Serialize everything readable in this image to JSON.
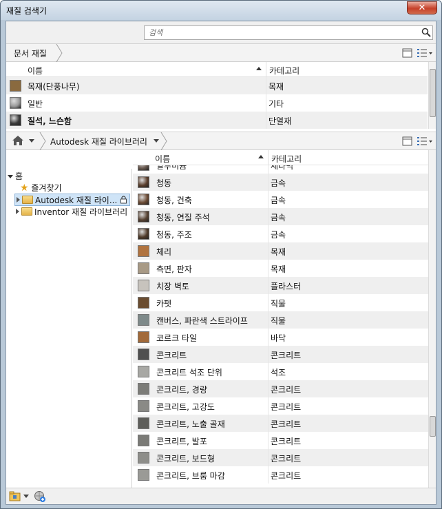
{
  "window": {
    "title": "재질 검색기",
    "close_label": "✕"
  },
  "search": {
    "placeholder": "검색"
  },
  "document": {
    "breadcrumb": "문서 재질",
    "columns": {
      "name": "이름",
      "category": "카테고리"
    },
    "rows": [
      {
        "name": "목재(단풍나무)",
        "category": "목재",
        "swatch": "#8a6a3f",
        "bold": false
      },
      {
        "name": "일반",
        "category": "기타",
        "swatch": "#9a9a9a",
        "bold": false
      },
      {
        "name": "질석, 느슨함",
        "category": "단열재",
        "swatch": "#3a3a3a",
        "bold": true
      }
    ]
  },
  "library": {
    "breadcrumb": "Autodesk 재질 라이브러리",
    "columns": {
      "name": "이름",
      "category": "카테고리"
    },
    "partial_top": {
      "name": "알루미늄",
      "category": "세라믹"
    },
    "rows": [
      {
        "name": "청동",
        "category": "금속",
        "swatch": "#5a3e2c"
      },
      {
        "name": "청동, 건축",
        "category": "금속",
        "swatch": "#6b4a33"
      },
      {
        "name": "청동, 연질 주석",
        "category": "금속",
        "swatch": "#574232"
      },
      {
        "name": "청동, 주조",
        "category": "금속",
        "swatch": "#4f3a2a"
      },
      {
        "name": "체리",
        "category": "목재",
        "swatch": "#b0733f"
      },
      {
        "name": "측면, 판자",
        "category": "목재",
        "swatch": "#a89a86"
      },
      {
        "name": "치장 벽토",
        "category": "플라스터",
        "swatch": "#c7c3bd"
      },
      {
        "name": "카펫",
        "category": "직물",
        "swatch": "#6a4c30"
      },
      {
        "name": "캔버스, 파란색 스트라이프",
        "category": "직물",
        "swatch": "#7f8a8a"
      },
      {
        "name": "코르크 타일",
        "category": "바닥",
        "swatch": "#a26a3a"
      },
      {
        "name": "콘크리트",
        "category": "콘크리트",
        "swatch": "#4f4f4f"
      },
      {
        "name": "콘크리트 석조 단위",
        "category": "석조",
        "swatch": "#a8a8a4"
      },
      {
        "name": "콘크리트, 경량",
        "category": "콘크리트",
        "swatch": "#7c7c78"
      },
      {
        "name": "콘크리트, 고강도",
        "category": "콘크리트",
        "swatch": "#8a8a86"
      },
      {
        "name": "콘크리트, 노출 골재",
        "category": "콘크리트",
        "swatch": "#5e5e5a"
      },
      {
        "name": "콘크리트, 발포",
        "category": "콘크리트",
        "swatch": "#7a7a76"
      },
      {
        "name": "콘크리트, 보드형",
        "category": "콘크리트",
        "swatch": "#8e8e8a"
      },
      {
        "name": "콘크리트, 브룸 마감",
        "category": "콘크리트",
        "swatch": "#9a9a96"
      }
    ]
  },
  "tree": {
    "home": "홈",
    "favorites": "즐겨찾기",
    "autodesk_lib": "Autodesk 재질 라이...",
    "inventor_lib": "Inventor 재질 라이브러리"
  },
  "icons": [
    "search-icon",
    "home-icon",
    "lock-icon",
    "star-icon",
    "folder-icon",
    "globe-plus-icon"
  ]
}
